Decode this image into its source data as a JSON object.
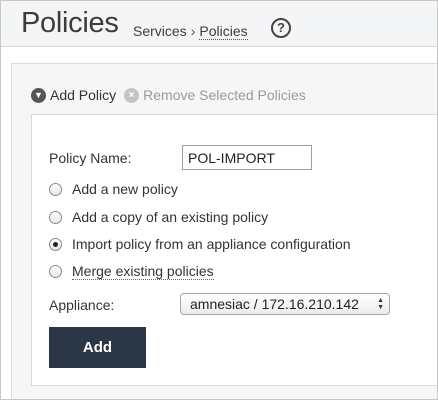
{
  "header": {
    "title": "Policies",
    "breadcrumb": {
      "parent": "Services",
      "separator": "›",
      "current": "Policies"
    },
    "help_glyph": "?"
  },
  "actions": {
    "add_policy": {
      "label": "Add Policy",
      "icon": "chevron-down-circle-icon"
    },
    "remove_selected": {
      "label": "Remove Selected Policies",
      "icon": "close-circle-icon"
    }
  },
  "form": {
    "policy_name_label": "Policy Name:",
    "policy_name_value": "POL-IMPORT",
    "options": [
      {
        "label": "Add a new policy",
        "checked": false
      },
      {
        "label": "Add a copy of an existing policy",
        "checked": false
      },
      {
        "label": "Import policy from an appliance configuration",
        "checked": true
      },
      {
        "label": "Merge existing policies",
        "checked": false
      }
    ],
    "appliance_label": "Appliance:",
    "appliance_value": "amnesiac / 172.16.210.142",
    "add_button": "Add"
  },
  "colors": {
    "button_bg": "#2b3746",
    "header_bg": "#f4f5f7",
    "disabled_text": "#9a9a9a"
  }
}
